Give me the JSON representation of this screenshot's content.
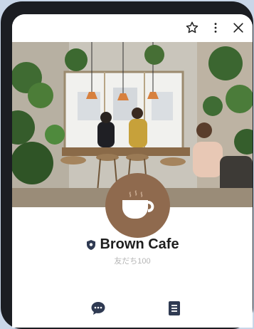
{
  "profile": {
    "name": "Brown Cafe",
    "friends_label": "友だち100"
  },
  "icons": {
    "star": "star-icon",
    "more": "more-vertical-icon",
    "close": "close-icon",
    "badge": "shield-badge-icon",
    "chat": "chat-bubble-icon",
    "notes": "document-icon",
    "avatar": "coffee-cup-icon"
  },
  "colors": {
    "avatar_bg": "#8f6a4e",
    "phone_frame": "#1b1d22",
    "background": "#c9d6e8",
    "badge": "#2f3a52"
  }
}
